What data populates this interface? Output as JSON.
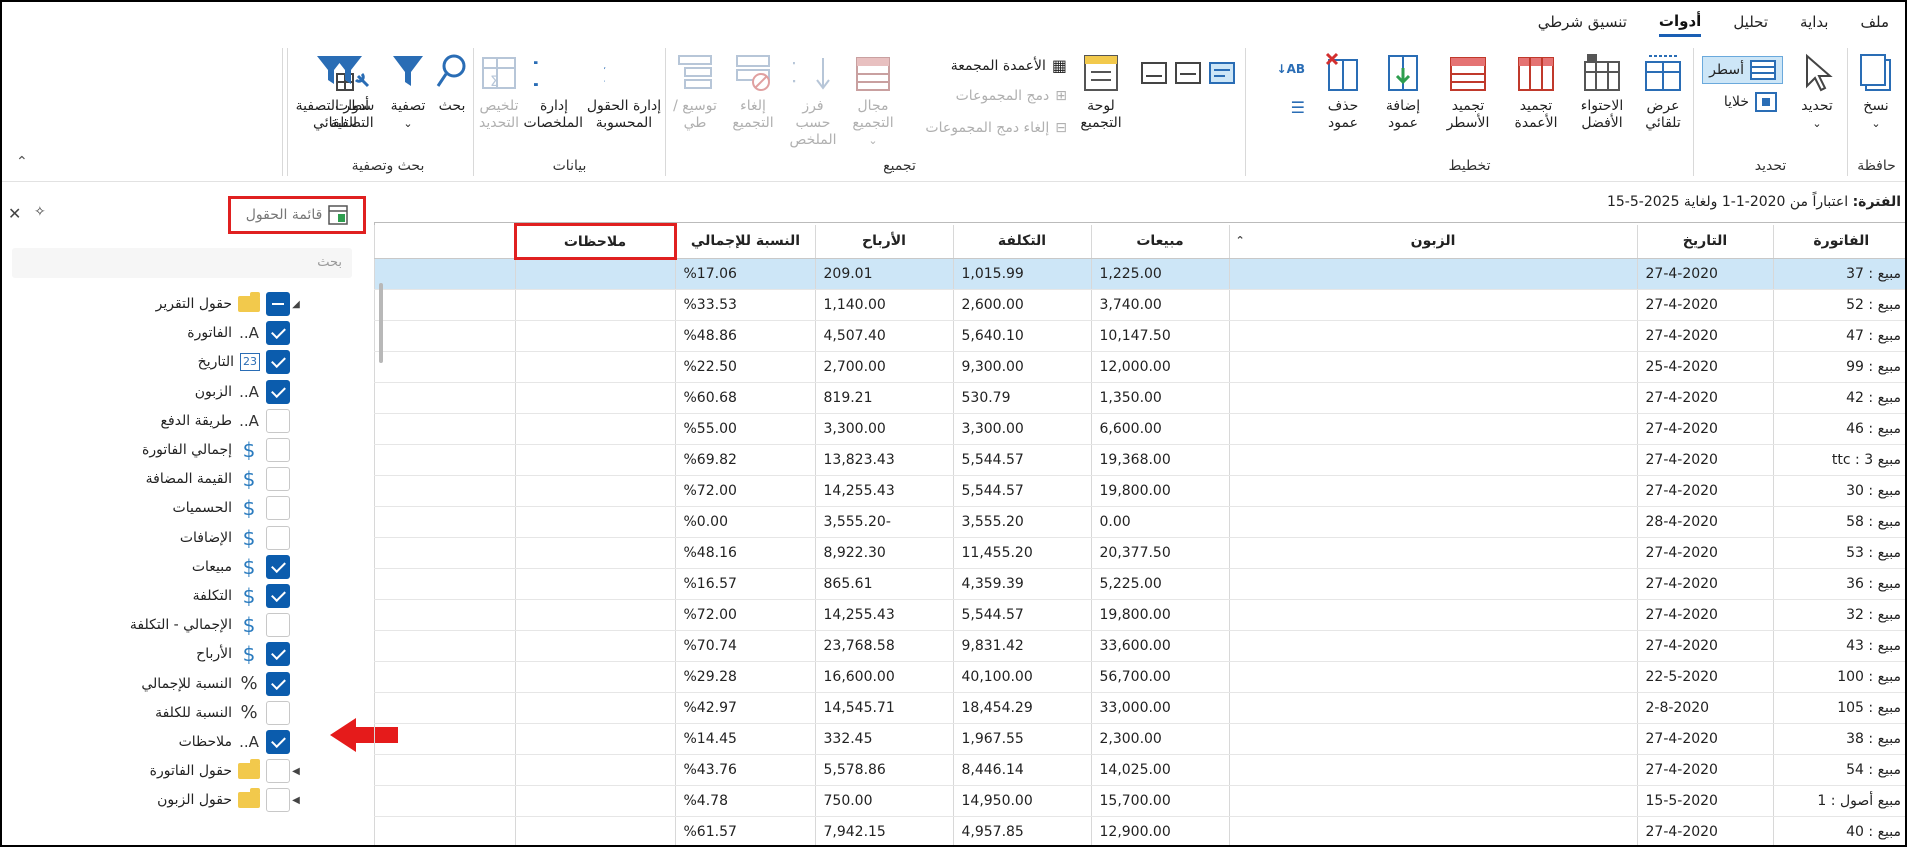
{
  "tabs": [
    {
      "label": "ملف",
      "active": false
    },
    {
      "label": "بداية",
      "active": false
    },
    {
      "label": "تحليل",
      "active": false
    },
    {
      "label": "أدوات",
      "active": true
    },
    {
      "label": "تنسيق شرطي",
      "active": false
    }
  ],
  "ribbon": {
    "clipboard": {
      "label": "حافظة",
      "copy": "نسخ"
    },
    "selection": {
      "label": "تحديد",
      "select": "تحديد",
      "rows": "أسطر",
      "cells": "خلايا"
    },
    "layout": {
      "label": "تخطيط",
      "auto_width": "عرض تلقائي",
      "best_fit": "الاحتواء الأفضل",
      "freeze_cols": "تجميد الأعمدة",
      "freeze_rows": "تجميد الأسطر",
      "add_col": "إضافة عمود",
      "del_col": "حذف عمود"
    },
    "grouping": {
      "label": "تجميع",
      "panel": "لوحة التجميع",
      "grouped_cols": "الأعمدة المجمعة",
      "merge_groups": "دمج المجموعات",
      "unmerge_groups": "إلغاء دمج المجموعات",
      "group_range": "مجال التجميع",
      "sort_summary": "فرز حسب الملخص",
      "ungroup": "إلغاء التجميع",
      "expand_collapse": "توسيع / طي"
    },
    "data": {
      "label": "بيانات",
      "calc_fields": "إدارة الحقول المحسوبة",
      "summaries": "إدارة الملخصات",
      "summarize_sel": "تلخيص التحديد"
    },
    "search": {
      "label": "بحث وتصفية",
      "search": "بحث",
      "filter": "تصفية",
      "auto_filter": "سطر التصفية التلقائي",
      "filter_tools": "أدوات التصفية"
    }
  },
  "period": {
    "label": "الفترة:",
    "text": "اعتباراً من 2020-1-1 ولغاية 2025-5-15"
  },
  "panel": {
    "title": "قائمة الحقول",
    "search_placeholder": "بحث",
    "fields": [
      {
        "label": "حقول التقرير",
        "type": "folder",
        "state": "part",
        "level": 0
      },
      {
        "label": "الفاتورة",
        "type": "text",
        "state": "on",
        "level": 1
      },
      {
        "label": "التاريخ",
        "type": "date",
        "state": "on",
        "level": 1
      },
      {
        "label": "الزبون",
        "type": "text",
        "state": "on",
        "level": 1
      },
      {
        "label": "طريقة الدفع",
        "type": "text",
        "state": "off",
        "level": 1
      },
      {
        "label": "إجمالي الفاتورة",
        "type": "dollar",
        "state": "off",
        "level": 1
      },
      {
        "label": "القيمة المضافة",
        "type": "dollar",
        "state": "off",
        "level": 1
      },
      {
        "label": "الحسميات",
        "type": "dollar",
        "state": "off",
        "level": 1
      },
      {
        "label": "الإضافات",
        "type": "dollar",
        "state": "off",
        "level": 1
      },
      {
        "label": "مبيعات",
        "type": "dollar",
        "state": "on",
        "level": 1
      },
      {
        "label": "التكلفة",
        "type": "dollar",
        "state": "on",
        "level": 1
      },
      {
        "label": "الإجمالي - التكلفة",
        "type": "dollar",
        "state": "off",
        "level": 1
      },
      {
        "label": "الأرباح",
        "type": "dollar",
        "state": "on",
        "level": 1
      },
      {
        "label": "النسبة للإجمالي",
        "type": "pct",
        "state": "on",
        "level": 1
      },
      {
        "label": "النسبة للكلفة",
        "type": "pct",
        "state": "off",
        "level": 1
      },
      {
        "label": "ملاحظات",
        "type": "text",
        "state": "on",
        "level": 1
      },
      {
        "label": "حقول الفاتورة",
        "type": "folder",
        "state": "off",
        "level": 0
      },
      {
        "label": "حقول الزبون",
        "type": "folder",
        "state": "off",
        "level": 0
      }
    ]
  },
  "grid": {
    "headers": [
      "الفاتورة",
      "التاريخ",
      "الزبون",
      "مبيعات",
      "التكلفة",
      "الأرباح",
      "النسبة للإجمالي",
      "ملاحظات"
    ],
    "rows": [
      [
        "مبيع : 37",
        "27-4-2020",
        "",
        "1,225.00",
        "1,015.99",
        "209.01",
        "%17.06",
        ""
      ],
      [
        "مبيع : 52",
        "27-4-2020",
        "",
        "3,740.00",
        "2,600.00",
        "1,140.00",
        "%33.53",
        ""
      ],
      [
        "مبيع : 47",
        "27-4-2020",
        "",
        "10,147.50",
        "5,640.10",
        "4,507.40",
        "%48.86",
        ""
      ],
      [
        "مبيع : 99",
        "25-4-2020",
        "",
        "12,000.00",
        "9,300.00",
        "2,700.00",
        "%22.50",
        ""
      ],
      [
        "مبيع : 42",
        "27-4-2020",
        "",
        "1,350.00",
        "530.79",
        "819.21",
        "%60.68",
        ""
      ],
      [
        "مبيع : 46",
        "27-4-2020",
        "",
        "6,600.00",
        "3,300.00",
        "3,300.00",
        "%55.00",
        ""
      ],
      [
        "مبيع 3 : ttc",
        "27-4-2020",
        "",
        "19,368.00",
        "5,544.57",
        "13,823.43",
        "%69.82",
        ""
      ],
      [
        "مبيع : 30",
        "27-4-2020",
        "",
        "19,800.00",
        "5,544.57",
        "14,255.43",
        "%72.00",
        ""
      ],
      [
        "مبيع : 58",
        "28-4-2020",
        "",
        "0.00",
        "3,555.20",
        "-3,555.20",
        "%0.00",
        ""
      ],
      [
        "مبيع : 53",
        "27-4-2020",
        "",
        "20,377.50",
        "11,455.20",
        "8,922.30",
        "%48.16",
        ""
      ],
      [
        "مبيع : 36",
        "27-4-2020",
        "",
        "5,225.00",
        "4,359.39",
        "865.61",
        "%16.57",
        ""
      ],
      [
        "مبيع : 32",
        "27-4-2020",
        "",
        "19,800.00",
        "5,544.57",
        "14,255.43",
        "%72.00",
        ""
      ],
      [
        "مبيع : 43",
        "27-4-2020",
        "",
        "33,600.00",
        "9,831.42",
        "23,768.58",
        "%70.74",
        ""
      ],
      [
        "مبيع : 100",
        "22-5-2020",
        "",
        "56,700.00",
        "40,100.00",
        "16,600.00",
        "%29.28",
        ""
      ],
      [
        "مبيع : 105",
        "2-8-2020",
        "",
        "33,000.00",
        "18,454.29",
        "14,545.71",
        "%42.97",
        ""
      ],
      [
        "مبيع : 38",
        "27-4-2020",
        "",
        "2,300.00",
        "1,967.55",
        "332.45",
        "%14.45",
        ""
      ],
      [
        "مبيع : 54",
        "27-4-2020",
        "",
        "14,025.00",
        "8,446.14",
        "5,578.86",
        "%43.76",
        ""
      ],
      [
        "مبيع أصول : 1",
        "15-5-2020",
        "",
        "15,700.00",
        "14,950.00",
        "750.00",
        "%4.78",
        ""
      ],
      [
        "مبيع : 40",
        "27-4-2020",
        "",
        "12,900.00",
        "4,957.85",
        "7,942.15",
        "%61.57",
        ""
      ]
    ]
  },
  "colors": {
    "accent": "#1a5fb4",
    "checkbox": "#0b5cad",
    "highlight": "#e02020",
    "selected_row": "#cde6f7"
  }
}
